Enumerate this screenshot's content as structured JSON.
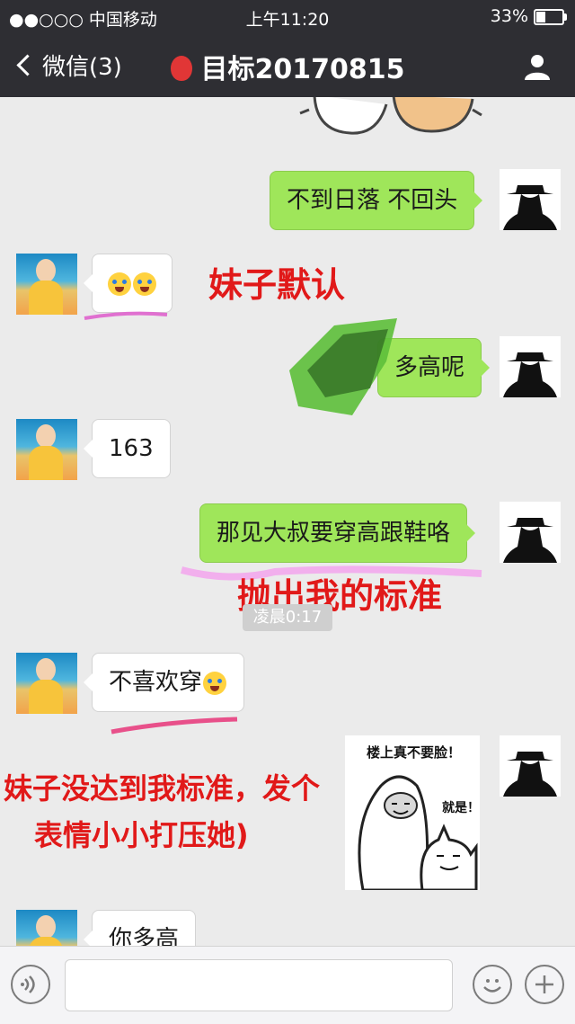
{
  "status_bar": {
    "carrier": "●●○○○ 中国移动",
    "time": "上午11:20",
    "battery": "33%",
    "battery_level": 0.33
  },
  "nav": {
    "back_label": "微信(3)",
    "title": "目标20170815",
    "balloon_color": "#e13636"
  },
  "messages": [
    {
      "side": "out",
      "text": "不到日落 不回头"
    },
    {
      "side": "in",
      "text": "",
      "emoji": [
        "crying-face-icon",
        "crying-face-icon"
      ]
    },
    {
      "side": "out",
      "text": "多高呢",
      "scribbled": true
    },
    {
      "side": "in",
      "text": "163"
    },
    {
      "side": "out",
      "text": "那见大叔要穿高跟鞋咯"
    },
    {
      "side": "in",
      "text": "不喜欢穿",
      "emoji": [
        "crying-face-icon"
      ]
    },
    {
      "side": "out",
      "sticker": {
        "top_text": "楼上真不要脸！",
        "bottom_text": "就是！"
      }
    },
    {
      "side": "in",
      "text": "你多高"
    }
  ],
  "timestamp": "凌晨0:17",
  "annotations": {
    "a1": "妹子默认",
    "a2": "抛出我的标准",
    "a3_line1": "妹子没达到我标准，发个",
    "a3_line2": "表情小小打压她)"
  },
  "colors": {
    "nav_bg": "#2e2e33",
    "chat_bg": "#ebebeb",
    "out_bubble": "#9fe65a",
    "annotation_red": "#e11919"
  }
}
